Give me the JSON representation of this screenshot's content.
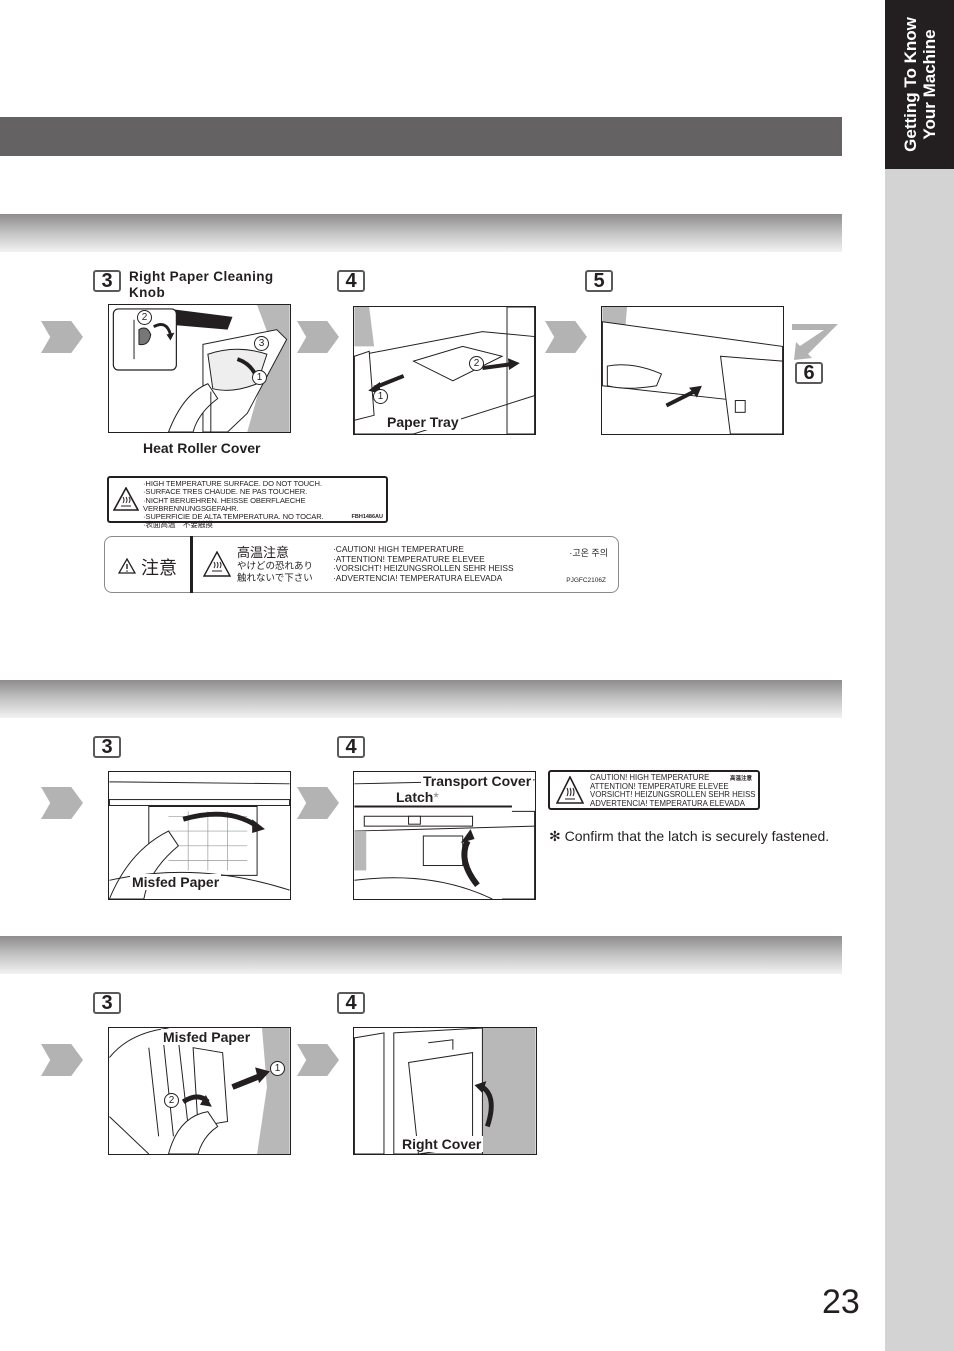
{
  "side_tab": {
    "line1": "Getting To Know",
    "line2": "Your Machine"
  },
  "section1": {
    "steps": [
      {
        "number": "3",
        "label": "Right Paper Cleaning Knob",
        "callouts": [
          "Heat Roller Cover"
        ],
        "markers": [
          "2",
          "3",
          "1"
        ]
      },
      {
        "number": "4",
        "label": "",
        "callouts": [
          "Paper Tray"
        ],
        "markers": [
          "1",
          "2"
        ]
      },
      {
        "number": "5",
        "label": "",
        "callouts": [],
        "markers": []
      }
    ],
    "next_step": "6",
    "warning_label_1": {
      "lines": [
        "·HIGH TEMPERATURE SURFACE. DO NOT TOUCH.",
        "·SURFACE TRES CHAUDE. NE PAS TOUCHER.",
        "·NICHT BERUEHREN. HEISSE OBERFLAECHE VERBRENNUNGSGEFAHR.",
        "·SUPERFICIE DE ALTA TEMPERATURA. NO TOCAR.",
        "·表面高温　不要触摸"
      ],
      "code": "FBH1486AU"
    },
    "warning_label_2": {
      "caution_jp": "注意",
      "title_jp": "高温注意",
      "jp_lines": [
        "やけどの恐れあり",
        "触れないで下さい"
      ],
      "lines": [
        "·CAUTION! HIGH TEMPERATURE",
        "·ATTENTION! TEMPERATURE ELEVEE",
        "·VORSICHT! HEIZUNGSROLLEN SEHR HEISS",
        "·ADVERTENCIA! TEMPERATURA ELEVADA"
      ],
      "korean": "·고온 주의",
      "code": "PJGFC2106Z"
    }
  },
  "section2": {
    "steps": [
      {
        "number": "3",
        "callouts": [
          "Misfed Paper"
        ]
      },
      {
        "number": "4",
        "callouts": [
          "Transport Cover",
          "Latch"
        ],
        "latch_mark": "*"
      }
    ],
    "warning_label": {
      "lines": [
        "CAUTION! HIGH TEMPERATURE",
        "ATTENTION! TEMPERATURE ELEVEE",
        "VORSICHT! HEIZUNGSROLLEN SEHR HEISS",
        "ADVERTENCIA! TEMPERATURA ELEVADA"
      ],
      "jp": "高温注意"
    },
    "note": "✻ Confirm that the latch is securely fastened."
  },
  "section3": {
    "steps": [
      {
        "number": "3",
        "callouts": [
          "Misfed Paper"
        ],
        "markers": [
          "1",
          "2"
        ]
      },
      {
        "number": "4",
        "callouts": [
          "Right Cover"
        ]
      }
    ]
  },
  "page_number": "23"
}
